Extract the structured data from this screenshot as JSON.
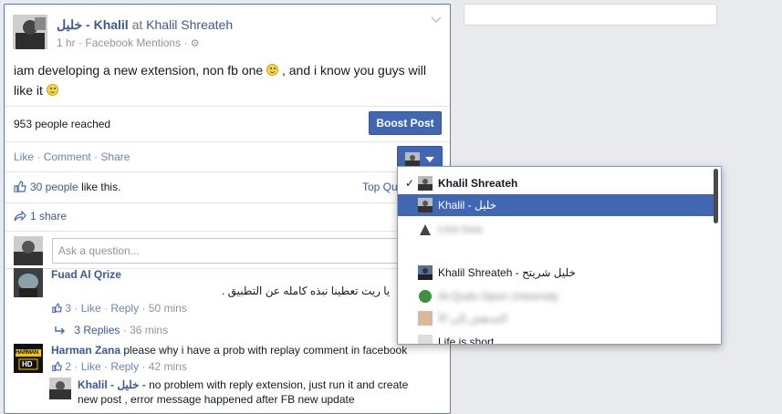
{
  "post": {
    "author_name": "Khalil",
    "author_prefix": "خليل - ",
    "at_word": "at",
    "page_name": "Khalil Shreateh",
    "time": "1 hr",
    "sep": "·",
    "source": "Facebook Mentions",
    "audience_glyph": "⚙",
    "text_part1": "iam developing a new extension, non fb one",
    "text_part2": ", and i know you guys will like it",
    "reached": "953 people reached",
    "boost_label": "Boost Post"
  },
  "actions": {
    "like": "Like",
    "comment": "Comment",
    "share": "Share",
    "dot": "·"
  },
  "likes": {
    "count_label": "30 people",
    "suffix": "like this.",
    "top_label": "Top Qu"
  },
  "shares": {
    "label": "1 share"
  },
  "ask": {
    "placeholder": "Ask a question..."
  },
  "comments": [
    {
      "name": "Fuad Al Qrize",
      "text": "يا ريت تعطينا نبذه كامله عن التطبيق .",
      "likes": "3",
      "like": "Like",
      "reply": "Reply",
      "time": "50 mins",
      "replies_label": "3 Replies",
      "replies_time": "36 mins"
    },
    {
      "name": "Harman Zana",
      "text": "please why i have a prob with replay comment in facebook",
      "likes": "2",
      "like": "Like",
      "reply": "Reply",
      "time": "42 mins",
      "badge_top": "HARMAN",
      "badge_bottom": "HD"
    },
    {
      "name": "Khalil",
      "name_prefix": "خليل - ",
      "text_line1": "no problem with reply extension, just run it and create",
      "text_line2": "new post , error message happened after FB new update"
    }
  ],
  "dropdown": {
    "check": "✓",
    "items": [
      {
        "label": "Khalil Shreateh",
        "bold": true,
        "checked": true
      },
      {
        "label": "Khalil - خليل",
        "selected": true
      },
      {
        "label": "Lina Issa",
        "blurred": true
      },
      {
        "label": "",
        "empty": true
      },
      {
        "label": "Khalil Shreateh - خليل شريتح"
      },
      {
        "label": "Al-Quds Open University",
        "blurred": true
      },
      {
        "label": "المدهش إلي الأ",
        "blurred": true
      },
      {
        "label": "Life is short"
      }
    ]
  },
  "colors": {
    "brand": "#4267b2",
    "link": "#3b5998",
    "muted": "#90949c"
  }
}
